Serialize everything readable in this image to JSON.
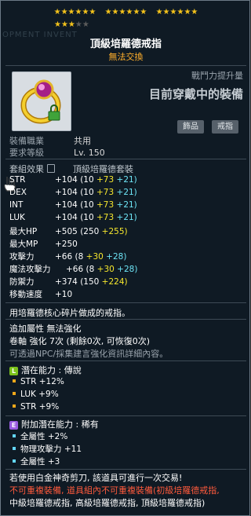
{
  "stars": {
    "row1": [
      "★★★★★★",
      "★★★★★★",
      "★★★★★★"
    ],
    "row2_filled": "★★★",
    "row2_dim": "★★"
  },
  "header": {
    "bg_word": "OPMENT INVENT",
    "item_name": "頂級培羅德戒指",
    "trade": "無法交換"
  },
  "combat_power": {
    "label": "戰鬥力提升量",
    "value": "目前穿戴中的裝備"
  },
  "tags": [
    "飾品",
    "戒指"
  ],
  "requirements": [
    {
      "label": "裝備職業",
      "value": "共用"
    },
    {
      "label": "要求等級",
      "value": "Lv. 150"
    }
  ],
  "set": {
    "label": "套組效果",
    "value": "頂級培羅德套裝"
  },
  "stats": [
    {
      "name": "STR",
      "total": "+104",
      "base": "(10",
      "y": "+73",
      "c": "+21)"
    },
    {
      "name": "DEX",
      "total": "+104",
      "base": "(10",
      "y": "+73",
      "c": "+21)"
    },
    {
      "name": "INT",
      "total": "+104",
      "base": "(10",
      "y": "+73",
      "c": "+21)"
    },
    {
      "name": "LUK",
      "total": "+104",
      "base": "(10",
      "y": "+73",
      "c": "+21)"
    },
    {
      "name": "最大HP",
      "total": "+505",
      "base": "(250",
      "y": "+255)",
      "c": ""
    },
    {
      "name": "最大MP",
      "total": "+250",
      "base": "",
      "y": "",
      "c": ""
    },
    {
      "name": "攻擊力",
      "total": "+66",
      "base": "(8",
      "y": "+30",
      "c": "+28)"
    },
    {
      "name": "魔法攻擊力",
      "total": "+66",
      "base": "(8",
      "y": "+30",
      "c": "+28)"
    },
    {
      "name": "防禦力",
      "total": "+374",
      "base": "(150",
      "y": "+224)",
      "c": ""
    },
    {
      "name": "移動速度",
      "total": "+10",
      "base": "",
      "y": "",
      "c": ""
    }
  ],
  "description": "用培羅德核心碎片做成的戒指。",
  "extra": {
    "line1": "追加屬性 無法強化",
    "line2": "卷軸 強化 7次 (剩餘0次, 可恢復0次)",
    "line3": "可透過NPC/採集建言強化資訊詳細內容。"
  },
  "potential": {
    "badge": "L",
    "badge_color": "#7cc21c",
    "title": "潛在能力 : 傳說",
    "lines": [
      "STR +12%",
      "LUK +9%",
      "STR +9%"
    ],
    "bullet_color": "#f0a81a"
  },
  "bonus_potential": {
    "badge": "E",
    "badge_color": "#9a5ce0",
    "title": "附加潛在能力 : 稀有",
    "lines": [
      "全屬性 +2%",
      "物理攻擊力 +11",
      "全屬性 +3"
    ],
    "bullet_color": "#63d7ff"
  },
  "warnings": {
    "line1": "若使用白金神奇剪刀, 該道具可進行一次交易!",
    "line2": "不可重複裝備, 道具組內不可重複裝備(初級培羅德戒指,",
    "line3": "中級培羅德戒指, 高級培羅德戒指, 頂級培羅德戒指)"
  },
  "colors": {
    "star": "#f3c21b",
    "yellow": "#f6e72d",
    "cyan": "#6de4f5",
    "warning_red": "#ff5a3c"
  }
}
